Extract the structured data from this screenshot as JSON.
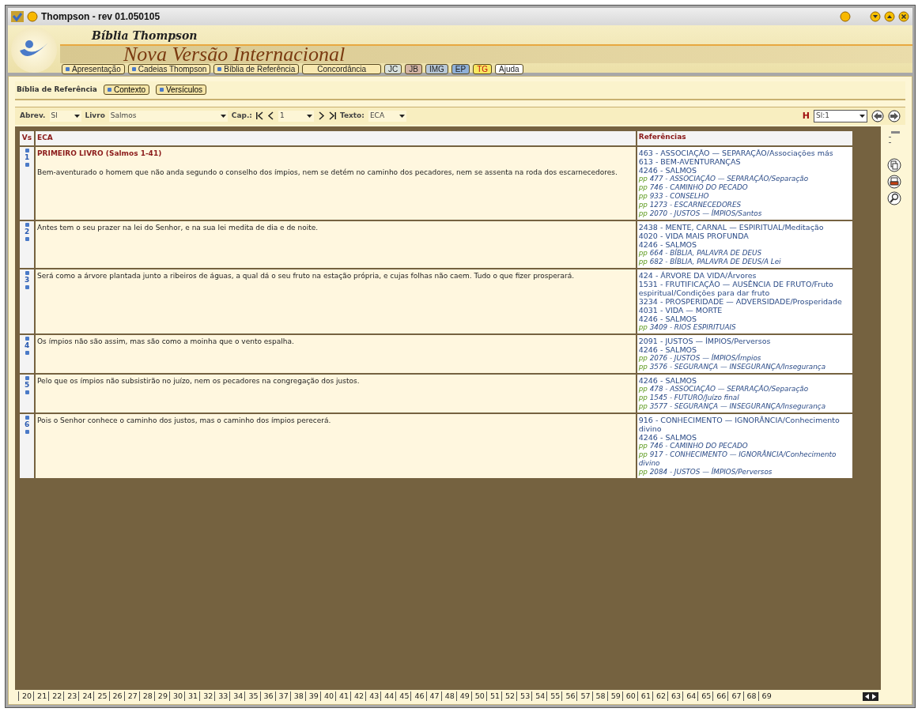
{
  "window": {
    "title": "Thompson - rev 01.050105"
  },
  "header": {
    "title": "Bíblia  Thompson",
    "subtitle": "Nova Versão Internacional"
  },
  "nav": [
    {
      "label": "Apresentação",
      "kind": "dot",
      "color": "#f8e8b0"
    },
    {
      "label": "Cadeias Thompson",
      "kind": "dot",
      "color": "#f8e8b0"
    },
    {
      "label": "Bíblia de Referência",
      "kind": "dot",
      "color": "#f8e8b0"
    },
    {
      "label": "Concordância",
      "kind": "wide",
      "color": "#f8e8b0"
    },
    {
      "label": "JC",
      "kind": "plain",
      "color": "#d8e0dc"
    },
    {
      "label": "JB",
      "kind": "plain",
      "color": "#d4b4a4"
    },
    {
      "label": "IMG",
      "kind": "plain",
      "color": "#b8c8d8"
    },
    {
      "label": "EP",
      "kind": "plain",
      "color": "#90b0d8"
    },
    {
      "label": "TG",
      "kind": "alert",
      "color": "#f8e860"
    },
    {
      "label": "Ajuda",
      "kind": "plain",
      "color": "#ffffff"
    }
  ],
  "section": {
    "title": "Bíblia de Referência",
    "buttons": [
      "Contexto",
      "Versículos"
    ]
  },
  "toolbar": {
    "abrev_label": "Abrev.",
    "abrev": "Sl",
    "livro_label": "Livro",
    "livro": "Salmos",
    "cap_label": "Cap.:",
    "cap": "1",
    "texto_label": "Texto:",
    "texto": "ECA",
    "h": "H",
    "ref": "Sl:1"
  },
  "table": {
    "columns": [
      "Vs",
      "ECA",
      "Referências"
    ],
    "rows": [
      {
        "verse": "1",
        "heading": "PRIMEIRO LIVRO (Salmos 1-41)",
        "text": "Bem-aventurado o homem que não anda segundo o conselho dos ímpios, nem se detém no caminho dos pecadores, nem se assenta na roda dos escarnecedores.",
        "refs": [
          {
            "kind": "topic",
            "text": "463 - ASSOCIAÇÃO — SEPARAÇÃO/Associações más"
          },
          {
            "kind": "topic",
            "text": "613 - BEM-AVENTURANÇAS"
          },
          {
            "kind": "topic",
            "text": "4246 - SALMOS"
          },
          {
            "kind": "pp",
            "prefix": "pp",
            "text": "477 - ASSOCIAÇÃO — SEPARAÇÃO/Separação"
          },
          {
            "kind": "pp",
            "prefix": "pp",
            "text": "746 - CAMINHO DO PECADO"
          },
          {
            "kind": "pp",
            "prefix": "pp",
            "text": "933 - CONSELHO"
          },
          {
            "kind": "pp",
            "prefix": "pp",
            "text": "1273 - ESCARNECEDORES"
          },
          {
            "kind": "pp",
            "prefix": "pp",
            "text": "2070 - JUSTOS — ÍMPIOS/Santos"
          }
        ]
      },
      {
        "verse": "2",
        "text": "Antes tem o seu prazer na lei do Senhor, e na sua lei medita de dia e de noite.",
        "refs": [
          {
            "kind": "topic",
            "text": "2438 - MENTE, CARNAL — ESPIRITUAL/Meditação"
          },
          {
            "kind": "topic",
            "text": "4020 - VIDA MAIS PROFUNDA"
          },
          {
            "kind": "topic",
            "text": "4246 - SALMOS"
          },
          {
            "kind": "pp",
            "prefix": "pp",
            "text": "664 - BÍBLIA, PALAVRA DE DEUS"
          },
          {
            "kind": "pp",
            "prefix": "pp",
            "text": "682 - BÍBLIA, PALAVRA DE DEUS/A Lei"
          }
        ]
      },
      {
        "verse": "3",
        "text": "Será como a árvore plantada junto a ribeiros de águas, a qual dá o seu fruto na estação própria, e cujas folhas não caem. Tudo o que fizer prosperará.",
        "refs": [
          {
            "kind": "topic",
            "text": "424 - ÁRVORE DA VIDA/Árvores"
          },
          {
            "kind": "topic",
            "text": "1531 - FRUTIFICAÇÃO — AUSÊNCIA DE FRUTO/Fruto espiritual/Condições para dar fruto"
          },
          {
            "kind": "topic",
            "text": "3234 - PROSPERIDADE — ADVERSIDADE/Prosperidade"
          },
          {
            "kind": "topic",
            "text": "4031 - VIDA — MORTE"
          },
          {
            "kind": "topic",
            "text": "4246 - SALMOS"
          },
          {
            "kind": "pp",
            "prefix": "pp",
            "text": "3409 - RIOS ESPIRITUAIS"
          }
        ]
      },
      {
        "verse": "4",
        "text": "Os ímpios não são assim, mas são como a moinha que o vento espalha.",
        "refs": [
          {
            "kind": "topic",
            "text": "2091 - JUSTOS — ÍMPIOS/Perversos"
          },
          {
            "kind": "topic",
            "text": "4246 - SALMOS"
          },
          {
            "kind": "pp",
            "prefix": "pp",
            "text": "2076 - JUSTOS — ÍMPIOS/Ímpios"
          },
          {
            "kind": "pp",
            "prefix": "pp",
            "text": "3576 - SEGURANÇA — INSEGURANÇA/Insegurança"
          }
        ]
      },
      {
        "verse": "5",
        "text": "Pelo que os ímpios não subsistirão no juízo, nem os pecadores na congregação dos justos.",
        "refs": [
          {
            "kind": "topic",
            "text": "4246 - SALMOS"
          },
          {
            "kind": "pp",
            "prefix": "pp",
            "text": "478 - ASSOCIAÇÃO — SEPARAÇÃO/Separação"
          },
          {
            "kind": "pp",
            "prefix": "pp",
            "text": "1545 - FUTURO/Juízo final"
          },
          {
            "kind": "pp",
            "prefix": "pp",
            "text": "3577 - SEGURANÇA — INSEGURANÇA/Insegurança"
          }
        ]
      },
      {
        "verse": "6",
        "text": "Pois o Senhor conhece o caminho dos justos, mas o caminho dos ímpios perecerá.",
        "refs": [
          {
            "kind": "topic",
            "text": "916 - CONHECIMENTO — IGNORÂNCIA/Conhecimento divino"
          },
          {
            "kind": "topic",
            "text": "4246 - SALMOS"
          },
          {
            "kind": "pp",
            "prefix": "pp",
            "text": "746 - CAMINHO DO PECADO"
          },
          {
            "kind": "pp",
            "prefix": "pp",
            "text": "917 - CONHECIMENTO — IGNORÂNCIA/Conhecimento divino"
          },
          {
            "kind": "pp",
            "prefix": "pp",
            "text": "2084 - JUSTOS — ÍMPIOS/Perversos"
          }
        ]
      }
    ]
  },
  "chapter_tabs": [
    {
      "label": "20",
      "selected": false
    },
    {
      "label": "21",
      "selected": false
    },
    {
      "label": "22",
      "selected": false
    },
    {
      "label": "23",
      "selected": false
    },
    {
      "label": "24",
      "selected": false
    },
    {
      "label": "25",
      "selected": false
    },
    {
      "label": "26",
      "selected": false
    },
    {
      "label": "27",
      "selected": false
    },
    {
      "label": "28",
      "selected": false
    },
    {
      "label": "29",
      "selected": false
    },
    {
      "label": "30",
      "selected": false
    },
    {
      "label": "31",
      "selected": false
    },
    {
      "label": "32",
      "selected": false
    },
    {
      "label": "33",
      "selected": false
    },
    {
      "label": "34",
      "selected": false
    },
    {
      "label": "35",
      "selected": false
    },
    {
      "label": "36",
      "selected": false
    },
    {
      "label": "37",
      "selected": false
    },
    {
      "label": "38",
      "selected": false
    },
    {
      "label": "39",
      "selected": false
    },
    {
      "label": "40",
      "selected": false
    },
    {
      "label": "41",
      "selected": false
    },
    {
      "label": "42",
      "selected": false
    },
    {
      "label": "43",
      "selected": false
    },
    {
      "label": "44",
      "selected": false
    },
    {
      "label": "45",
      "selected": false
    },
    {
      "label": "46",
      "selected": false
    },
    {
      "label": "47",
      "selected": false
    },
    {
      "label": "48",
      "selected": false
    },
    {
      "label": "49",
      "selected": false
    },
    {
      "label": "50",
      "selected": false
    },
    {
      "label": "51",
      "selected": false
    },
    {
      "label": "52",
      "selected": false
    },
    {
      "label": "53",
      "selected": false
    },
    {
      "label": "54",
      "selected": false
    },
    {
      "label": "55",
      "selected": false
    },
    {
      "label": "56",
      "selected": false
    },
    {
      "label": "57",
      "selected": false
    },
    {
      "label": "58",
      "selected": false
    },
    {
      "label": "59",
      "selected": false
    },
    {
      "label": "60",
      "selected": false
    },
    {
      "label": "61",
      "selected": false
    },
    {
      "label": "62",
      "selected": false
    },
    {
      "label": "63",
      "selected": false
    },
    {
      "label": "64",
      "selected": false
    },
    {
      "label": "65",
      "selected": false
    },
    {
      "label": "66",
      "selected": false
    },
    {
      "label": "67",
      "selected": false
    },
    {
      "label": "68",
      "selected": false
    },
    {
      "label": "69",
      "selected": false
    }
  ]
}
